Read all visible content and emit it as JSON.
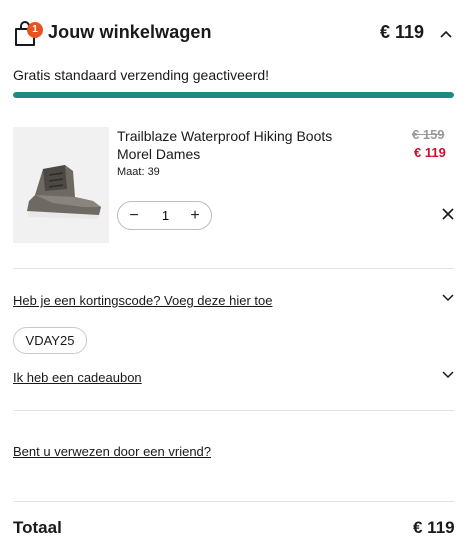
{
  "header": {
    "title": "Jouw winkelwagen",
    "total": "€ 119",
    "badge_count": "1",
    "icons": {
      "bag": "shopping-bag-icon",
      "collapse": "chevron-up-icon"
    }
  },
  "shipping": {
    "message": "Gratis standaard verzending geactiveerd!",
    "progress": 1.0,
    "progress_color": "#1c8a7e"
  },
  "item": {
    "name": "Trailblaze Waterproof Hiking Boots Morel Dames",
    "size": "Maat: 39",
    "old_price": "€ 159",
    "new_price": "€ 119",
    "quantity": "1",
    "minus_label": "−",
    "plus_label": "+",
    "sale_color": "#c8102e",
    "image_icon": "hiking-boot-icon"
  },
  "discount": {
    "link": "Heb je een kortingscode? Voeg deze hier toe",
    "applied_code": "VDAY25"
  },
  "gift": {
    "link": "Ik heb een cadeaubon"
  },
  "referral": {
    "link": "Bent u verwezen door een vriend?"
  },
  "summary": {
    "label": "Totaal",
    "value": "€ 119"
  },
  "colors": {
    "badge": "#e6541f"
  }
}
